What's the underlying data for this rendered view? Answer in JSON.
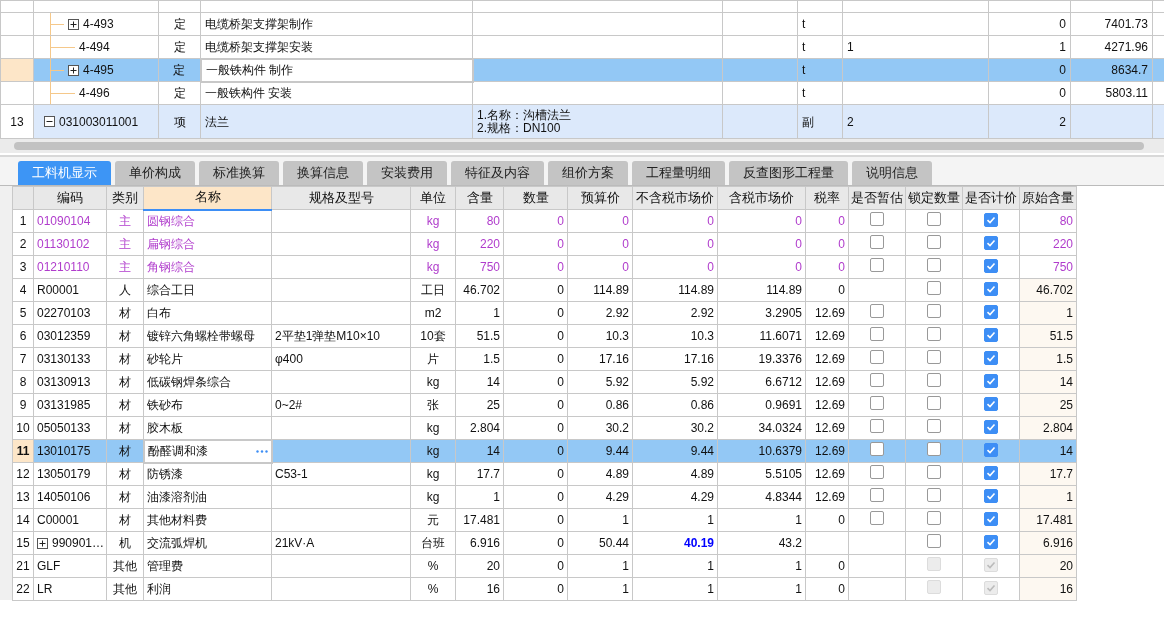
{
  "top_table": {
    "rows": [
      {
        "children": [
          {
            "code": "4-493",
            "type": "定",
            "name": "电缆桥架支撑架制作",
            "unit": "t",
            "quantity": "0",
            "price": "7401.73",
            "expanded": false,
            "selected": false
          },
          {
            "code": "4-494",
            "type": "定",
            "name": "电缆桥架支撑架安装",
            "unit": "t",
            "expression": "1",
            "quantity": "1",
            "price": "4271.96",
            "selected": false
          },
          {
            "code": "4-495",
            "type": "定",
            "name": "一般铁构件 制作",
            "unit": "t",
            "quantity": "0",
            "price": "8634.7",
            "expanded": false,
            "selected": true
          },
          {
            "code": "4-496",
            "type": "定",
            "name": "一般铁构件 安装",
            "unit": "t",
            "quantity": "0",
            "price": "5803.11",
            "selected": false
          }
        ]
      },
      {
        "no": "13",
        "code": "031003011001",
        "type": "项",
        "name": "法兰",
        "features": [
          "1.名称：沟槽法兰",
          "2.规格：DN100"
        ],
        "unit": "副",
        "expression": "2",
        "quantity": "2",
        "expanded": true
      }
    ]
  },
  "tabs": [
    {
      "label": "工料机显示",
      "selected": true
    },
    {
      "label": "单价构成",
      "selected": false
    },
    {
      "label": "标准换算",
      "selected": false
    },
    {
      "label": "换算信息",
      "selected": false
    },
    {
      "label": "安装费用",
      "selected": false
    },
    {
      "label": "特征及内容",
      "selected": false
    },
    {
      "label": "组价方案",
      "selected": false
    },
    {
      "label": "工程量明细",
      "selected": false
    },
    {
      "label": "反查图形工程量",
      "selected": false
    },
    {
      "label": "说明信息",
      "selected": false
    }
  ],
  "columns": [
    {
      "label": "编码",
      "selected": false
    },
    {
      "label": "类别",
      "selected": false
    },
    {
      "label": "名称",
      "selected": true
    },
    {
      "label": "规格及型号",
      "selected": false
    },
    {
      "label": "单位",
      "selected": false
    },
    {
      "label": "含量",
      "selected": false
    },
    {
      "label": "数量",
      "selected": false
    },
    {
      "label": "预算价",
      "selected": false
    },
    {
      "label": "不含税市场价",
      "selected": false
    },
    {
      "label": "含税市场价",
      "selected": false
    },
    {
      "label": "税率",
      "selected": false
    },
    {
      "label": "是否暂估",
      "selected": false
    },
    {
      "label": "锁定数量",
      "selected": false
    },
    {
      "label": "是否计价",
      "selected": false
    },
    {
      "label": "原始含量",
      "selected": false
    }
  ],
  "rows": [
    {
      "no": "1",
      "code": "01090104",
      "type": "主",
      "name": "圆钢综合",
      "unit": "kg",
      "ratio": "80",
      "amount": "0",
      "budget_price": "0",
      "market_price": "0",
      "market_price_tax": "0",
      "tax_rate": "0",
      "provisional": {
        "checked": false
      },
      "locked": {
        "checked": false,
        "disabled": false
      },
      "priced": {
        "checked": true,
        "disabled": false
      },
      "original": "80",
      "emphasis": true,
      "selected": false
    },
    {
      "no": "2",
      "code": "01130102",
      "type": "主",
      "name": "扁钢综合",
      "unit": "kg",
      "ratio": "220",
      "amount": "0",
      "budget_price": "0",
      "market_price": "0",
      "market_price_tax": "0",
      "tax_rate": "0",
      "provisional": {
        "checked": false
      },
      "locked": {
        "checked": false,
        "disabled": false
      },
      "priced": {
        "checked": true,
        "disabled": false
      },
      "original": "220",
      "emphasis": true,
      "selected": false
    },
    {
      "no": "3",
      "code": "01210110",
      "type": "主",
      "name": "角钢综合",
      "unit": "kg",
      "ratio": "750",
      "amount": "0",
      "budget_price": "0",
      "market_price": "0",
      "market_price_tax": "0",
      "tax_rate": "0",
      "provisional": {
        "checked": false
      },
      "locked": {
        "checked": false,
        "disabled": false
      },
      "priced": {
        "checked": true,
        "disabled": false
      },
      "original": "750",
      "emphasis": true,
      "selected": false
    },
    {
      "no": "4",
      "code": "R00001",
      "type": "人",
      "name": "综合工日",
      "unit": "工日",
      "ratio": "46.702",
      "amount": "0",
      "budget_price": "114.89",
      "market_price": "114.89",
      "market_price_tax": "114.89",
      "tax_rate": "0",
      "locked": {
        "checked": false,
        "disabled": false
      },
      "priced": {
        "checked": true,
        "disabled": false
      },
      "original": "46.702",
      "emphasis": false,
      "selected": false
    },
    {
      "no": "5",
      "code": "02270103",
      "type": "材",
      "name": "白布",
      "unit": "m2",
      "ratio": "1",
      "amount": "0",
      "budget_price": "2.92",
      "market_price": "2.92",
      "market_price_tax": "3.2905",
      "tax_rate": "12.69",
      "provisional": {
        "checked": false
      },
      "locked": {
        "checked": false,
        "disabled": false
      },
      "priced": {
        "checked": true,
        "disabled": false
      },
      "original": "1",
      "emphasis": false,
      "selected": false
    },
    {
      "no": "6",
      "code": "03012359",
      "type": "材",
      "name": "镀锌六角螺栓带螺母",
      "spec": "2平垫1弹垫M10×10",
      "unit": "10套",
      "ratio": "51.5",
      "amount": "0",
      "budget_price": "10.3",
      "market_price": "10.3",
      "market_price_tax": "11.6071",
      "tax_rate": "12.69",
      "provisional": {
        "checked": false
      },
      "locked": {
        "checked": false,
        "disabled": false
      },
      "priced": {
        "checked": true,
        "disabled": false
      },
      "original": "51.5",
      "emphasis": false,
      "selected": false
    },
    {
      "no": "7",
      "code": "03130133",
      "type": "材",
      "name": "砂轮片",
      "spec": "φ400",
      "unit": "片",
      "ratio": "1.5",
      "amount": "0",
      "budget_price": "17.16",
      "market_price": "17.16",
      "market_price_tax": "19.3376",
      "tax_rate": "12.69",
      "provisional": {
        "checked": false
      },
      "locked": {
        "checked": false,
        "disabled": false
      },
      "priced": {
        "checked": true,
        "disabled": false
      },
      "original": "1.5",
      "emphasis": false,
      "selected": false
    },
    {
      "no": "8",
      "code": "03130913",
      "type": "材",
      "name": "低碳钢焊条综合",
      "unit": "kg",
      "ratio": "14",
      "amount": "0",
      "budget_price": "5.92",
      "market_price": "5.92",
      "market_price_tax": "6.6712",
      "tax_rate": "12.69",
      "provisional": {
        "checked": false
      },
      "locked": {
        "checked": false,
        "disabled": false
      },
      "priced": {
        "checked": true,
        "disabled": false
      },
      "original": "14",
      "emphasis": false,
      "selected": false
    },
    {
      "no": "9",
      "code": "03131985",
      "type": "材",
      "name": "铁砂布",
      "spec": "0~2#",
      "unit": "张",
      "ratio": "25",
      "amount": "0",
      "budget_price": "0.86",
      "market_price": "0.86",
      "market_price_tax": "0.9691",
      "tax_rate": "12.69",
      "provisional": {
        "checked": false
      },
      "locked": {
        "checked": false,
        "disabled": false
      },
      "priced": {
        "checked": true,
        "disabled": false
      },
      "original": "25",
      "emphasis": false,
      "selected": false
    },
    {
      "no": "10",
      "code": "05050133",
      "type": "材",
      "name": "胶木板",
      "unit": "kg",
      "ratio": "2.804",
      "amount": "0",
      "budget_price": "30.2",
      "market_price": "30.2",
      "market_price_tax": "34.0324",
      "tax_rate": "12.69",
      "provisional": {
        "checked": false
      },
      "locked": {
        "checked": false,
        "disabled": false
      },
      "priced": {
        "checked": true,
        "disabled": false
      },
      "original": "2.804",
      "emphasis": false,
      "selected": false
    },
    {
      "no": "11",
      "code": "13010175",
      "type": "材",
      "name": "酚醛调和漆",
      "unit": "kg",
      "ratio": "14",
      "amount": "0",
      "budget_price": "9.44",
      "market_price": "9.44",
      "market_price_tax": "10.6379",
      "tax_rate": "12.69",
      "provisional": {
        "checked": false
      },
      "locked": {
        "checked": false,
        "disabled": false
      },
      "priced": {
        "checked": true,
        "disabled": false
      },
      "original": "14",
      "emphasis": false,
      "selected": true
    },
    {
      "no": "12",
      "code": "13050179",
      "type": "材",
      "name": "防锈漆",
      "spec": "C53-1",
      "unit": "kg",
      "ratio": "17.7",
      "amount": "0",
      "budget_price": "4.89",
      "market_price": "4.89",
      "market_price_tax": "5.5105",
      "tax_rate": "12.69",
      "provisional": {
        "checked": false
      },
      "locked": {
        "checked": false,
        "disabled": false
      },
      "priced": {
        "checked": true,
        "disabled": false
      },
      "original": "17.7",
      "emphasis": false,
      "selected": false
    },
    {
      "no": "13",
      "code": "14050106",
      "type": "材",
      "name": "油漆溶剂油",
      "unit": "kg",
      "ratio": "1",
      "amount": "0",
      "budget_price": "4.29",
      "market_price": "4.29",
      "market_price_tax": "4.8344",
      "tax_rate": "12.69",
      "provisional": {
        "checked": false
      },
      "locked": {
        "checked": false,
        "disabled": false
      },
      "priced": {
        "checked": true,
        "disabled": false
      },
      "original": "1",
      "emphasis": false,
      "selected": false
    },
    {
      "no": "14",
      "code": "C00001",
      "type": "材",
      "name": "其他材料费",
      "unit": "元",
      "ratio": "17.481",
      "amount": "0",
      "budget_price": "1",
      "market_price": "1",
      "market_price_tax": "1",
      "tax_rate": "0",
      "provisional": {
        "checked": false
      },
      "locked": {
        "checked": false,
        "disabled": false
      },
      "priced": {
        "checked": true,
        "disabled": false
      },
      "original": "17.481",
      "emphasis": false,
      "selected": false
    },
    {
      "no": "15",
      "code": "990901…",
      "type": "机",
      "name": "交流弧焊机",
      "spec": "21kV·A",
      "unit": "台班",
      "ratio": "6.916",
      "amount": "0",
      "budget_price": "50.44",
      "market_price": "40.19",
      "market_price_changed": true,
      "market_price_tax": "43.2",
      "locked": {
        "checked": false,
        "disabled": false
      },
      "priced": {
        "checked": true,
        "disabled": false
      },
      "original": "6.916",
      "emphasis": false,
      "selected": false,
      "expanded": false
    },
    {
      "no": "21",
      "code": "GLF",
      "type": "其他",
      "name": "管理费",
      "unit": "%",
      "ratio": "20",
      "amount": "0",
      "budget_price": "1",
      "market_price": "1",
      "market_price_tax": "1",
      "tax_rate": "0",
      "locked": {
        "checked": false,
        "disabled": true
      },
      "priced": {
        "checked": true,
        "disabled": true
      },
      "original": "20",
      "emphasis": false,
      "selected": false
    },
    {
      "no": "22",
      "code": "LR",
      "type": "其他",
      "name": "利润",
      "unit": "%",
      "ratio": "16",
      "amount": "0",
      "budget_price": "1",
      "market_price": "1",
      "market_price_tax": "1",
      "tax_rate": "0",
      "locked": {
        "checked": false,
        "disabled": true
      },
      "priced": {
        "checked": true,
        "disabled": true
      },
      "original": "16",
      "emphasis": false,
      "selected": false
    }
  ]
}
